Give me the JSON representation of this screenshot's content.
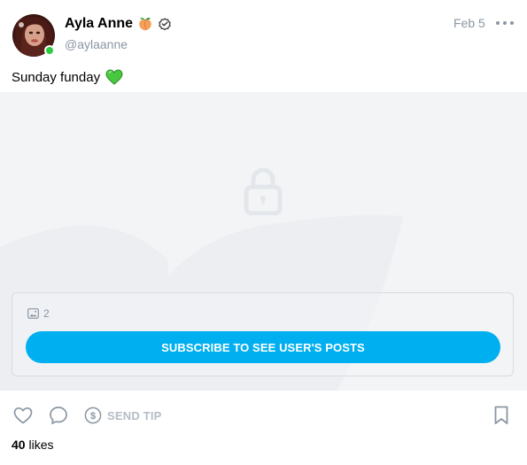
{
  "post": {
    "author": {
      "display_name": "Ayla Anne",
      "handle": "@aylaanne",
      "badge_icon": "peach-emoji-icon",
      "verified_icon": "verified-check-icon",
      "online": true,
      "online_color": "#2ecc40"
    },
    "date": "Feb 5",
    "caption": "Sunday funday",
    "caption_emoji": "green-heart-icon",
    "media": {
      "locked": true,
      "lock_icon": "lock-icon",
      "count_icon": "image-icon",
      "count": "2",
      "subscribe_label": "SUBSCRIBE TO SEE USER'S POSTS",
      "accent_color": "#00aff0"
    },
    "actions": {
      "tip_label": "SEND TIP"
    },
    "likes": {
      "count": "40",
      "label": "likes"
    }
  }
}
